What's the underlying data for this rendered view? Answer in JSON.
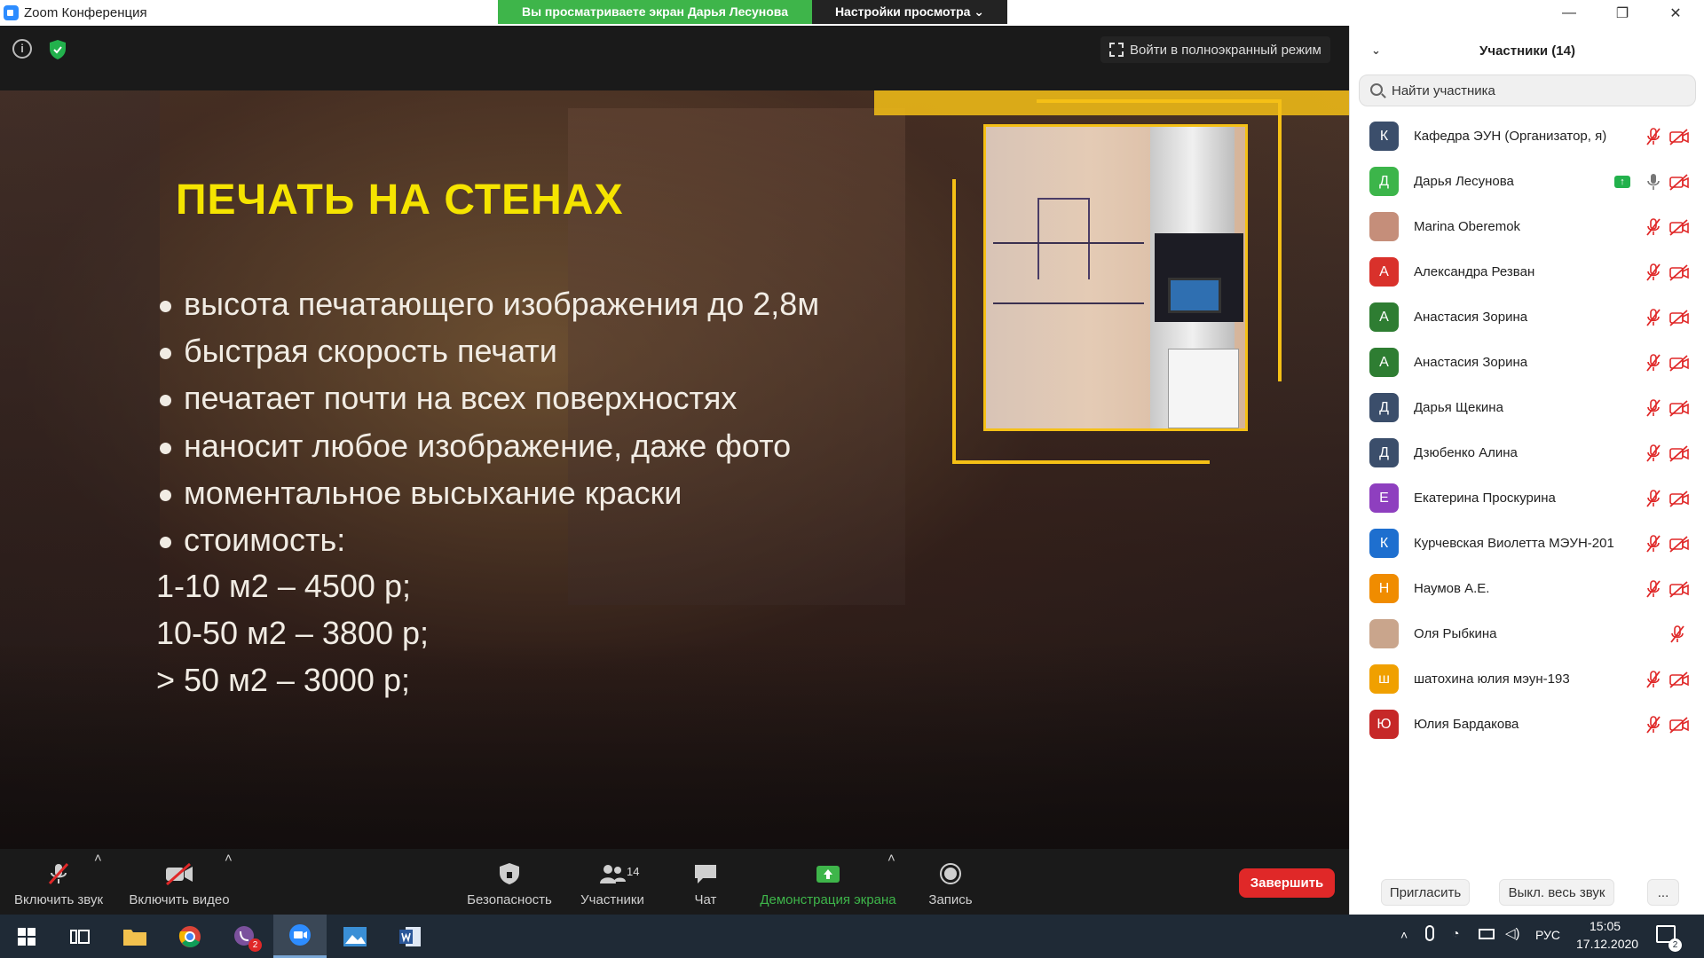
{
  "titlebar": {
    "app_title": "Zoom Конференция",
    "share_note": "Вы просматриваете экран Дарья Лесунова",
    "view_settings": "Настройки просмотра ⌄",
    "minimize": "—",
    "restore": "❐",
    "close": "✕"
  },
  "meeting": {
    "fullscreen_label": "Войти в полноэкранный режим",
    "info_glyph": "i"
  },
  "slide": {
    "title": "ПЕЧАТЬ НА СТЕНАХ",
    "bullets": [
      "высота печатающего изображения до 2,8м",
      "быстрая скорость печати",
      "печатает почти на всех поверхностях",
      "наносит любое изображение, даже фото",
      "моментальное высыхание краски",
      "стоимость:"
    ],
    "prices": [
      "1-10 м2 – 4500 р;",
      "10-50 м2 – 3800 р;",
      "> 50 м2 – 3000 р;"
    ]
  },
  "toolbar": {
    "audio_label": "Включить звук",
    "video_label": "Включить видео",
    "security_label": "Безопасность",
    "participants_label": "Участники",
    "participants_count": "14",
    "chat_label": "Чат",
    "share_label": "Демонстрация экрана",
    "record_label": "Запись",
    "end_label": "Завершить",
    "caret": "˄"
  },
  "panel": {
    "title": "Участники (14)",
    "collapse_glyph": "⌄",
    "search_placeholder": "Найти участника",
    "participants": [
      {
        "initial": "К",
        "name": "Кафедра ЭУН (Организатор, я)",
        "color": "#3b4e6b"
      },
      {
        "initial": "Д",
        "name": "Дарья Лесунова",
        "color": "#3cb54a"
      },
      {
        "initial": "",
        "name": "Marina Oberemok",
        "color": "#c58e7a"
      },
      {
        "initial": "А",
        "name": "Александра Резван",
        "color": "#d9312b"
      },
      {
        "initial": "А",
        "name": "Анастасия Зорина",
        "color": "#2e7d32"
      },
      {
        "initial": "А",
        "name": "Анастасия Зорина",
        "color": "#2e7d32"
      },
      {
        "initial": "Д",
        "name": "Дарья Щекина",
        "color": "#3b4e6b"
      },
      {
        "initial": "Д",
        "name": "Дзюбенко Алина",
        "color": "#3b4e6b"
      },
      {
        "initial": "Е",
        "name": "Екатерина Проскурина",
        "color": "#8e3fbf"
      },
      {
        "initial": "К",
        "name": "Курчевская Виолетта МЭУН-201",
        "color": "#1e6fcf"
      },
      {
        "initial": "Н",
        "name": "Наумов А.Е.",
        "color": "#f08c00"
      },
      {
        "initial": "",
        "name": "Оля Рыбкина",
        "color": "#c9a58c"
      },
      {
        "initial": "ш",
        "name": "шатохина юлия мэун-193",
        "color": "#f0a000"
      },
      {
        "initial": "Ю",
        "name": "Юлия Бардакова",
        "color": "#c62828"
      }
    ],
    "share_badge_glyph": "↑",
    "invite_label": "Пригласить",
    "mute_all_label": "Выкл. весь звук",
    "more_label": "..."
  },
  "taskbar": {
    "lang": "РУС",
    "time": "15:05",
    "date": "17.12.2020",
    "viber_badge": "2",
    "notif_badge": "2"
  },
  "colors": {
    "zoom_blue": "#2d8cff",
    "share_green": "#3eb54a",
    "end_red": "#e02828",
    "slide_yellow": "#f5e400",
    "frame_yellow": "#f5c016"
  }
}
